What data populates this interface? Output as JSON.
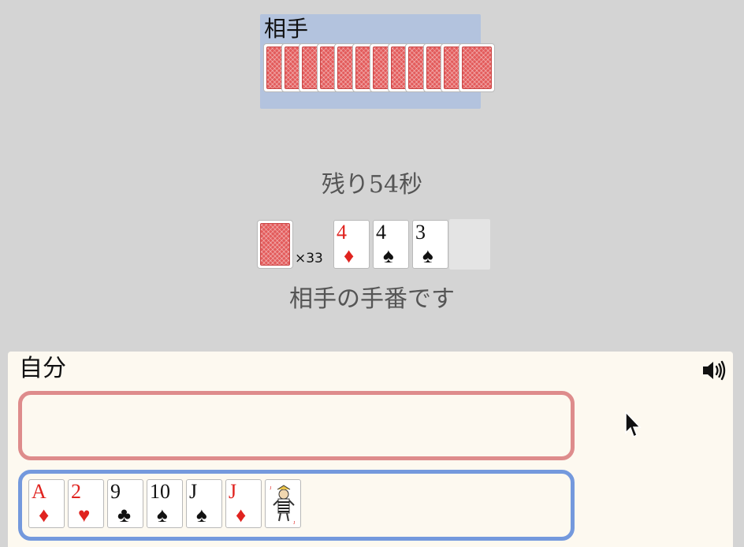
{
  "opponent": {
    "label": "相手",
    "card_count": 12
  },
  "status": {
    "timer": "残り54秒",
    "turn_message": "相手の手番です"
  },
  "deck": {
    "count_label": "×33"
  },
  "table_cards": [
    {
      "rank": "4",
      "suit": "♦",
      "color": "red"
    },
    {
      "rank": "4",
      "suit": "♠",
      "color": "black"
    },
    {
      "rank": "3",
      "suit": "♠",
      "color": "black"
    }
  ],
  "player": {
    "label": "自分",
    "hand": [
      {
        "rank": "A",
        "suit": "♦",
        "color": "red"
      },
      {
        "rank": "2",
        "suit": "♥",
        "color": "red"
      },
      {
        "rank": "9",
        "suit": "♣",
        "color": "black"
      },
      {
        "rank": "10",
        "suit": "♠",
        "color": "black"
      },
      {
        "rank": "J",
        "suit": "♠",
        "color": "black"
      },
      {
        "rank": "J",
        "suit": "♦",
        "color": "red"
      },
      {
        "rank": "",
        "suit": "",
        "color": "black",
        "joker": true
      }
    ]
  },
  "icons": {
    "sound": "speaker-icon",
    "cursor": "cursor-icon"
  },
  "colors": {
    "opponent_bg": "#b3c3de",
    "card_back": "#e35b5b",
    "play_zone_border": "#de8c8c",
    "hand_zone_border": "#7499dd",
    "player_bg": "#fdf9f0",
    "red_suit": "#e0231f"
  }
}
